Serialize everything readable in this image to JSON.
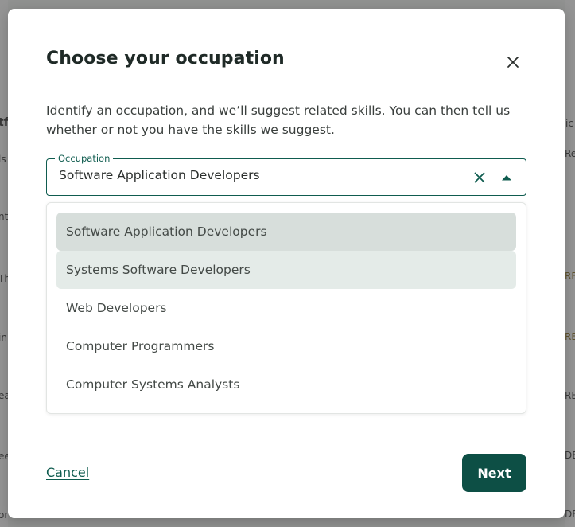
{
  "background": {
    "left_fragments": [
      "tf",
      "ls",
      "nt",
      "Th",
      "in",
      "ea",
      "ee",
      "or"
    ],
    "right_fragments": [
      "ic",
      "Re",
      "RE",
      "RE",
      "RE",
      "DE",
      "DE"
    ]
  },
  "modal": {
    "title": "Choose your occupation",
    "close_icon": "close-icon",
    "description": "Identify an occupation, and we’ll suggest related skills. You can then tell us whether or not you have the skills we suggest."
  },
  "occupation_field": {
    "label": "Occupation",
    "value": "Software Application Developers",
    "clear_icon": "clear-icon",
    "toggle_icon": "caret-up-icon"
  },
  "dropdown": {
    "options": [
      "Software Application Developers",
      "Systems Software Developers",
      "Web Developers",
      "Computer Programmers",
      "Computer Systems Analysts"
    ],
    "selected_index": 0,
    "hovered_index": 1
  },
  "footer": {
    "cancel_label": "Cancel",
    "next_label": "Next"
  },
  "colors": {
    "accent": "#0f5c4f",
    "button_bg": "#0d4f45",
    "selected_option_bg": "#d7dedb",
    "hovered_option_bg": "#e4ebe8"
  }
}
